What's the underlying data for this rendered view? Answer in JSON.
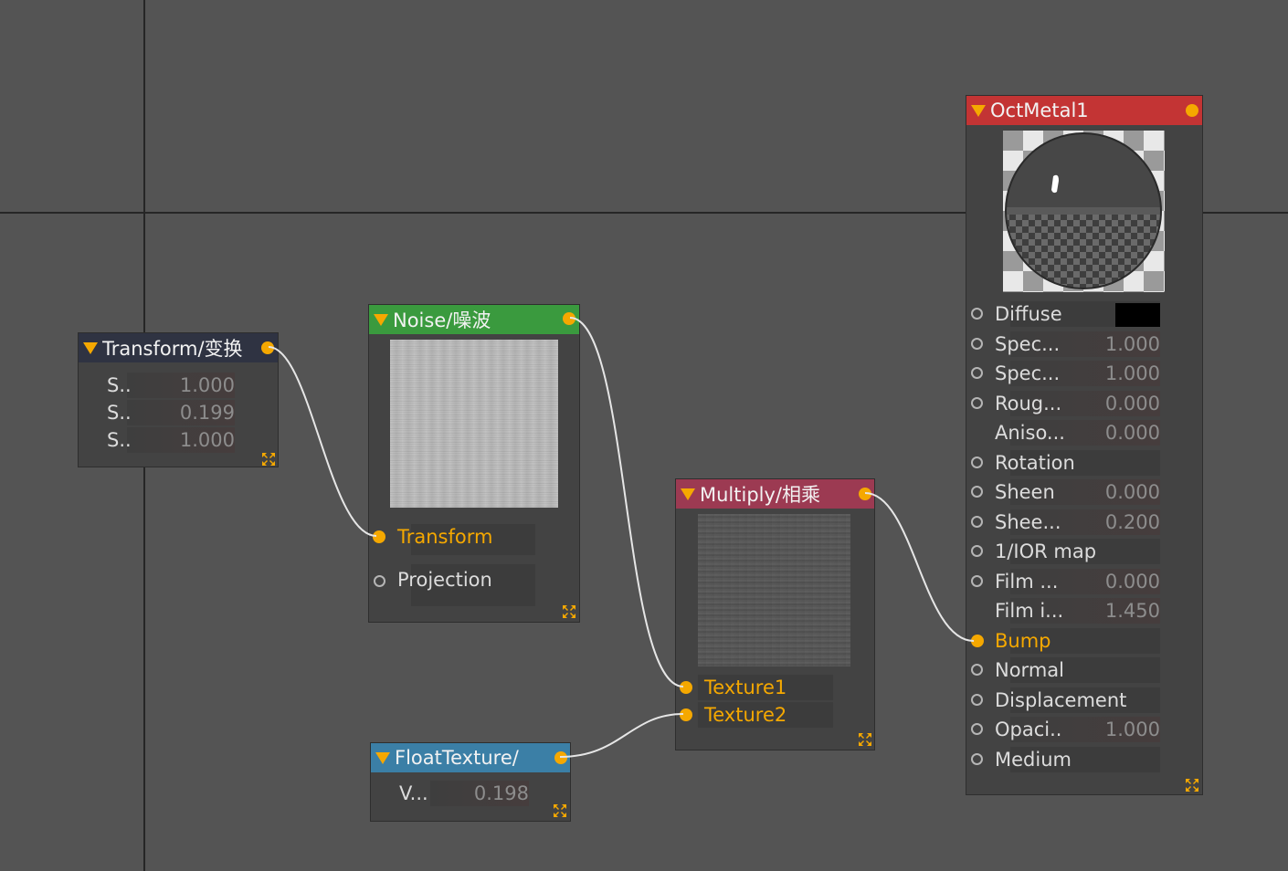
{
  "colors": {
    "background": "#545454",
    "node_body": "#434343",
    "port_active": "#f5a800",
    "wire": "#e6e6e6",
    "transform_header": "#2f3342",
    "noise_header": "#3a9a3e",
    "multiply_header": "#9c3a52",
    "float_header": "#3b7fa6",
    "metal_header": "#c33434"
  },
  "nodes": {
    "transform": {
      "title": "Transform/变换",
      "params": [
        {
          "label": "S..",
          "value": "1.000"
        },
        {
          "label": "S..",
          "value": "0.199"
        },
        {
          "label": "S..",
          "value": "1.000"
        }
      ]
    },
    "noise": {
      "title": "Noise/噪波",
      "inputs": [
        {
          "label": "Transform",
          "connected": true
        },
        {
          "label": "Projection",
          "connected": false
        }
      ]
    },
    "multiply": {
      "title": "Multiply/相乘",
      "inputs": [
        {
          "label": "Texture1",
          "connected": true
        },
        {
          "label": "Texture2",
          "connected": true
        }
      ]
    },
    "float_texture": {
      "title": "FloatTexture/",
      "params": [
        {
          "label": "V...",
          "value": "0.198"
        }
      ]
    },
    "metal": {
      "title": "OctMetal1",
      "inputs": [
        {
          "label": "Diffuse",
          "value": "",
          "port": "empty",
          "swatch": "#000000"
        },
        {
          "label": "Spec...",
          "value": "1.000",
          "port": "empty"
        },
        {
          "label": "Spec...",
          "value": "1.000",
          "port": "empty"
        },
        {
          "label": "Roug...",
          "value": "0.000",
          "port": "empty"
        },
        {
          "label": "Aniso...",
          "value": "0.000",
          "port": "none"
        },
        {
          "label": "Rotation",
          "value": "",
          "port": "empty"
        },
        {
          "label": "Sheen",
          "value": "0.000",
          "port": "empty"
        },
        {
          "label": "Shee...",
          "value": "0.200",
          "port": "empty"
        },
        {
          "label": "1/IOR map",
          "value": "",
          "port": "empty"
        },
        {
          "label": "Film ...",
          "value": "0.000",
          "port": "empty"
        },
        {
          "label": "Film i...",
          "value": "1.450",
          "port": "none"
        },
        {
          "label": "Bump",
          "value": "",
          "port": "filled"
        },
        {
          "label": "Normal",
          "value": "",
          "port": "empty"
        },
        {
          "label": "Displacement",
          "value": "",
          "port": "empty"
        },
        {
          "label": "Opaci..",
          "value": "1.000",
          "port": "empty"
        },
        {
          "label": "Medium",
          "value": "",
          "port": "empty"
        }
      ]
    }
  },
  "icons": {
    "collapse": "collapse-triangle-icon",
    "expand": "expand-arrows-icon",
    "port": "port-dot-icon"
  }
}
